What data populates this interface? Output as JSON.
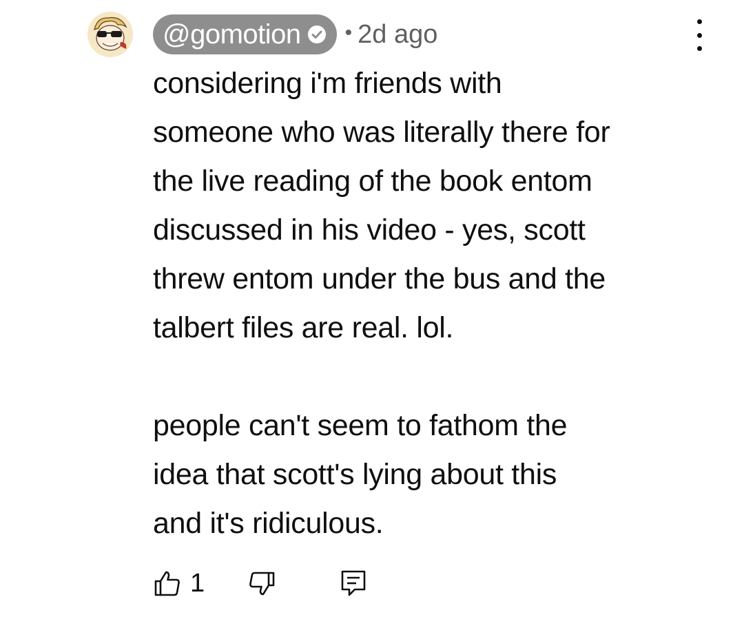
{
  "comment": {
    "author_handle": "@gomotion",
    "verified": true,
    "separator": "•",
    "timestamp": "2d ago",
    "paragraphs": [
      "considering i'm friends with\nsomeone who was literally there for\nthe live reading of the book entom\ndiscussed in his video - yes, scott\nthrew entom under the bus and the\ntalbert files are real. lol.",
      "people can't seem to fathom the\nidea that scott's lying about this\nand it's ridiculous."
    ],
    "like_count": "1"
  },
  "icons": {
    "avatar": "avatar-image",
    "verified": "verified-check-icon",
    "more": "more-vertical-icon",
    "like": "thumb-up-icon",
    "dislike": "thumb-down-icon",
    "reply": "reply-comment-icon"
  },
  "colors": {
    "handle_pill_bg": "#8e8e8e",
    "text": "#0f0f0f",
    "meta": "#606060"
  }
}
